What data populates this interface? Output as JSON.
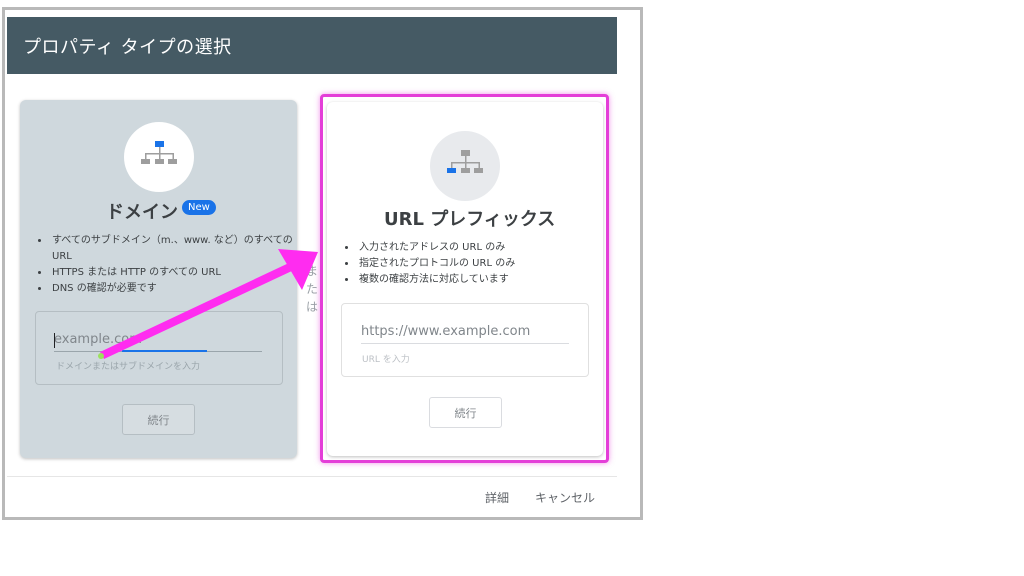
{
  "dialog": {
    "title": "プロパティ タイプの選択"
  },
  "domain_card": {
    "icon": "sitemap-icon",
    "title": "ドメイン",
    "badge": "New",
    "features": [
      "すべてのサブドメイン（m.、www. など）のすべての URL",
      "HTTPS または HTTP のすべての URL",
      "DNS の確認が必要です"
    ],
    "input_placeholder": "example.com",
    "input_helper": "ドメインまたはサブドメインを入力",
    "continue_label": "続行"
  },
  "divider": {
    "or_text": "また は"
  },
  "url_card": {
    "icon": "sitemap-icon",
    "title": "URL プレフィックス",
    "features": [
      "入力されたアドレスの URL のみ",
      "指定されたプロトコルの URL のみ",
      "複数の確認方法に対応しています"
    ],
    "input_placeholder": "https://www.example.com",
    "input_helper": "URL を入力",
    "continue_label": "続行"
  },
  "footer": {
    "details_label": "詳細",
    "cancel_label": "キャンセル"
  },
  "colors": {
    "header_bg": "#455a64",
    "accent_blue": "#1a73e8",
    "highlight_magenta": "#e43ed8",
    "arrow_magenta": "#ff2cf0",
    "arrow_tip_green": "#9be15d"
  }
}
